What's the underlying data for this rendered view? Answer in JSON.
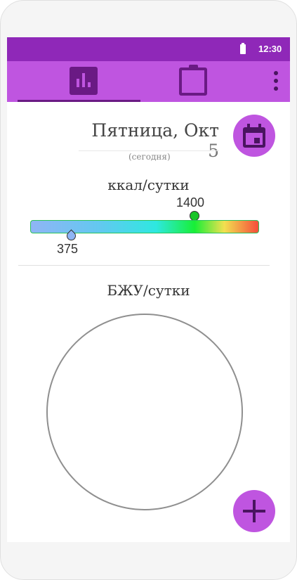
{
  "status_bar": {
    "time": "12:30",
    "battery_icon": "battery-icon"
  },
  "app_bar": {
    "tabs": [
      {
        "icon": "bar-chart-icon",
        "selected": true
      },
      {
        "icon": "clipboard-icon",
        "selected": false
      }
    ],
    "menu_icon": "more-vert-icon"
  },
  "date": {
    "weekday": "Пятница,",
    "month": "Окт",
    "day": "5",
    "subtitle": "(сегодня)"
  },
  "calendar_button_icon": "calendar-icon",
  "calories": {
    "title": "ккал/сутки",
    "target": "1400",
    "current": "375",
    "target_value": 1400,
    "current_value": 375
  },
  "macros": {
    "title": "БЖУ/сутки"
  },
  "fab_icon": "add-icon",
  "colors": {
    "primary": "#bf55e0",
    "primary_dark": "#8f28b8",
    "accent_dark": "#6a1a84"
  }
}
